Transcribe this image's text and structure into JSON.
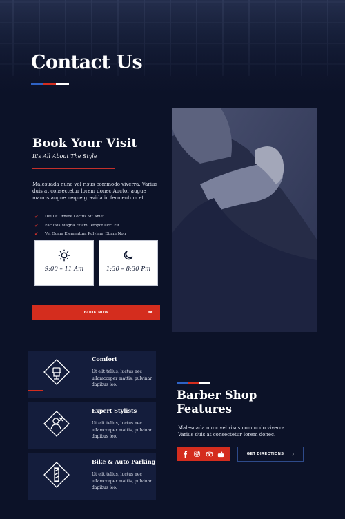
{
  "hero": {
    "title": "Contact Us"
  },
  "colors": {
    "blue": "#2f63c5",
    "red": "#d42d1e",
    "white": "#ffffff",
    "navy": "#0c1228",
    "card": "#141d3c"
  },
  "booking": {
    "title": "Book Your Visit",
    "subtitle": "It's All About The Style",
    "description": "Malesuada nunc vel risus commodo viverra. Varius duis at consectetur lorem donec.Auctor augue mauris augue neque gravida in fermentum et.",
    "checklist": [
      "Dui Ut Ornare Lectus Sit Amet",
      "Facilisis Magna Etiam Tempor Orci Eu",
      "Vel Quam Elementum Pulvinar Etiam Non"
    ],
    "hours": [
      {
        "icon": "sun-icon",
        "time": "9:00 – 11 Am"
      },
      {
        "icon": "moon-icon",
        "time": "1:30 – 8:30 Pm"
      }
    ],
    "button": "BOOK NOW",
    "button_icon": "scissors-icon"
  },
  "features": [
    {
      "icon": "barber-chair-icon",
      "title": "Comfort",
      "text": "Ut elit tellus, luctus nec ullamcorper mattis, pulvinar dapibus leo."
    },
    {
      "icon": "stylist-icon",
      "title": "Expert Stylists",
      "text": "Ut elit tellus, luctus nec ullamcorper mattis, pulvinar dapibus leo."
    },
    {
      "icon": "barber-pole-icon",
      "title": "Bike & Auto Parking",
      "text": "Ut elit tellus, luctus nec ullamcorper mattis, pulvinar dapibus leo."
    }
  ],
  "shop": {
    "title": "Barber Shop Features",
    "description": "Malesuada nunc vel risus commodo viverra. Varius duis at consectetur lorem donec.",
    "social": [
      "facebook-icon",
      "instagram-icon",
      "tripadvisor-icon",
      "youtube-icon"
    ],
    "button": "GET DIRECTIONS"
  }
}
